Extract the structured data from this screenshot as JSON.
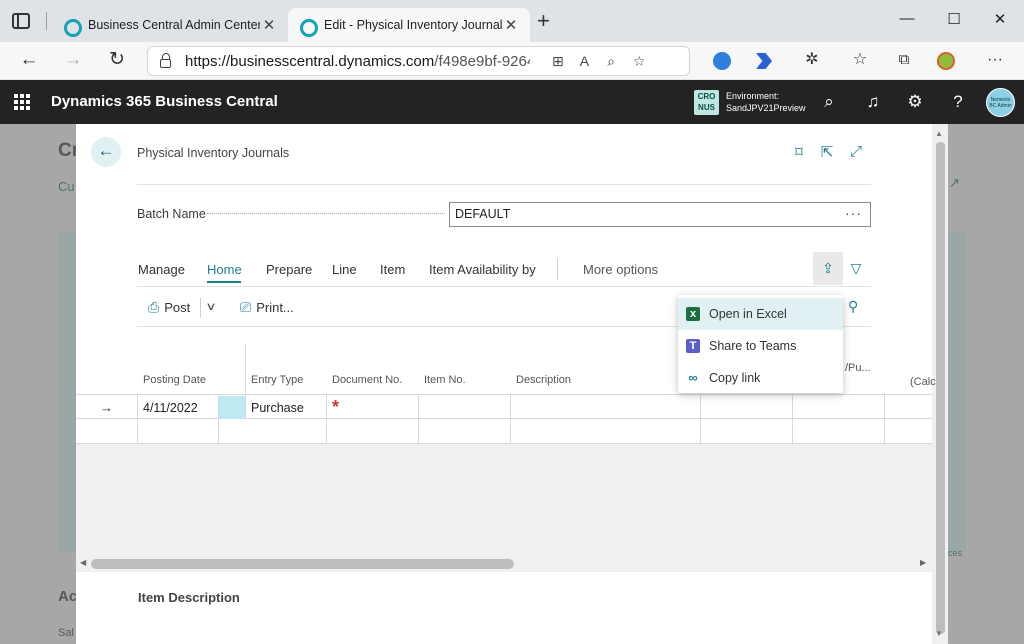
{
  "browser": {
    "tabs": [
      {
        "title": "Business Central Admin Center"
      },
      {
        "title": "Edit - Physical Inventory Journals"
      }
    ],
    "url_host": "https://businesscentral.dynamics.com",
    "url_path": "/f498e9bf-9264-..."
  },
  "app": {
    "title": "Dynamics 365 Business Central",
    "company_badge": "CRO\nNUS",
    "environment_label": "Environment:",
    "environment_name": "SandJPV21Preview",
    "avatar_text": "Nemesio BC Admin"
  },
  "background": {
    "frag_title": "Cr",
    "frag_link": "Cu",
    "frag_ac": "Ac",
    "frag_sal": "Sal",
    "frag_ces": "ces"
  },
  "page": {
    "breadcrumb": "Physical Inventory Journals",
    "batch_label": "Batch Name",
    "batch_value": "DEFAULT",
    "menu": [
      "Manage",
      "Home",
      "Prepare",
      "Line",
      "Item",
      "Item Availability by"
    ],
    "more_options": "More options",
    "actions": {
      "post": "Post",
      "print": "Print..."
    }
  },
  "share_menu": {
    "items": [
      "Open in Excel",
      "Share to Teams",
      "Copy link"
    ]
  },
  "grid": {
    "columns": [
      "Posting Date",
      "Entry Type",
      "Document No.",
      "Item No.",
      "Description",
      "/Pu...",
      "(Calc"
    ],
    "rows": [
      {
        "posting_date": "4/11/2022",
        "entry_type": "Purchase"
      }
    ]
  },
  "footer": {
    "item_description": "Item Description"
  },
  "colors": {
    "accent": "#1d7f8c",
    "required": "#d13438",
    "appbar": "#232323"
  }
}
